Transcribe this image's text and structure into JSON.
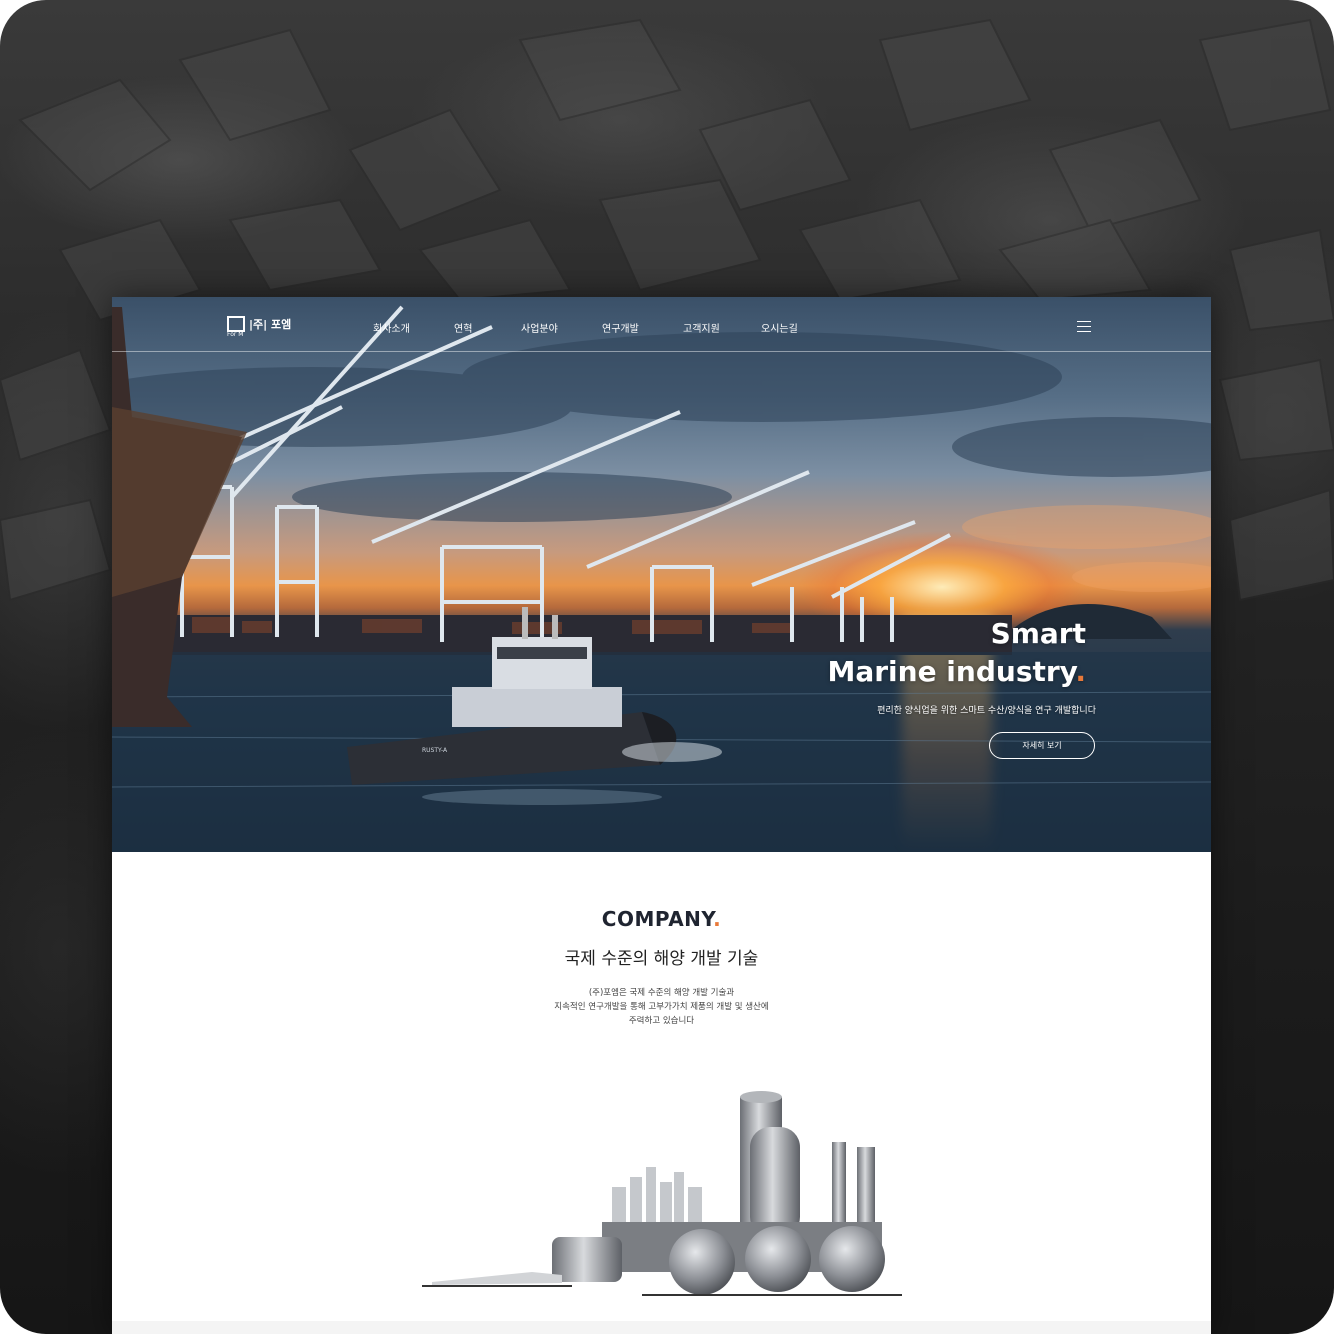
{
  "header": {
    "logo_text": "|주| 포엠",
    "logo_sub": "For M",
    "nav": [
      "회사소개",
      "연혁",
      "사업분야",
      "연구개발",
      "고객지원",
      "오시는길"
    ]
  },
  "hero": {
    "title_line1": "Smart",
    "title_line2": "Marine industry",
    "title_dot": ".",
    "subtitle": "편리한 양식업을 위한 스마트 수산/양식을 연구 개발합니다",
    "button_label": "자세히 보기",
    "boat_label": "RUSTY-A"
  },
  "company": {
    "title": "COMPANY",
    "title_dot": ".",
    "subtitle": "국제 수준의 해양 개발 기술",
    "desc": [
      "(주)포엠은 국제 수준의 해양 개발 기술과",
      "지속적인 연구개발을 통해 고부가가치 제품의 개발 및 생산에",
      "주력하고 있습니다"
    ]
  },
  "colors": {
    "accent": "#e8793a",
    "heading": "#1f2430"
  }
}
